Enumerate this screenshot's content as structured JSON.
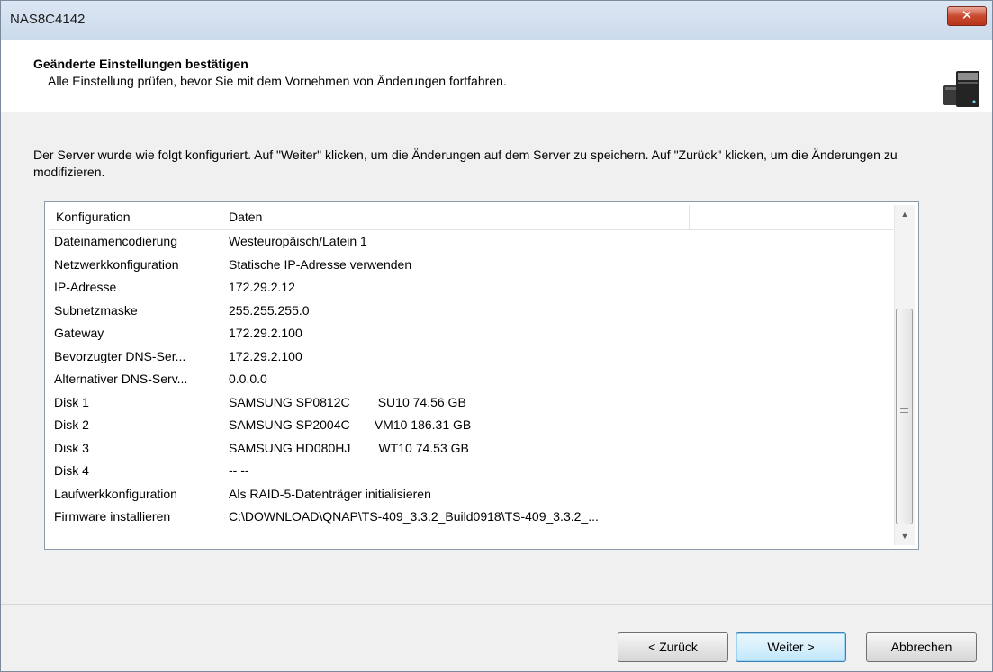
{
  "window": {
    "title": "NAS8C4142",
    "close_label": "✕"
  },
  "header": {
    "title": "Geänderte Einstellungen bestätigen",
    "subtitle": "Alle Einstellung prüfen, bevor Sie mit dem Vornehmen von Änderungen fortfahren.",
    "graphic_icon": "nas-server-icon"
  },
  "description": "Der Server wurde wie folgt konfiguriert. Auf \"Weiter\" klicken, um die Änderungen auf dem Server zu speichern. Auf \"Zurück\" klicken, um die Änderungen zu modifizieren.",
  "table": {
    "columns": [
      "Konfiguration",
      "Daten",
      ""
    ],
    "rows": [
      {
        "key": "Dateinamencodierung",
        "value": "Westeuropäisch/Latein 1"
      },
      {
        "key": "Netzwerkkonfiguration",
        "value": "Statische IP-Adresse verwenden"
      },
      {
        "key": "IP-Adresse",
        "value": "172.29.2.12"
      },
      {
        "key": "Subnetzmaske",
        "value": "255.255.255.0"
      },
      {
        "key": "Gateway",
        "value": "172.29.2.100"
      },
      {
        "key": "Bevorzugter DNS-Ser...",
        "value": "172.29.2.100"
      },
      {
        "key": "Alternativer DNS-Serv...",
        "value": "0.0.0.0"
      },
      {
        "key": "Disk 1",
        "value": "SAMSUNG SP0812C        SU10 74.56 GB"
      },
      {
        "key": "Disk 2",
        "value": "SAMSUNG SP2004C       VM10 186.31 GB"
      },
      {
        "key": "Disk 3",
        "value": "SAMSUNG HD080HJ        WT10 74.53 GB"
      },
      {
        "key": "Disk 4",
        "value": "-- --"
      },
      {
        "key": "Laufwerkkonfiguration",
        "value": "Als RAID-5-Datenträger initialisieren"
      },
      {
        "key": "Firmware installieren",
        "value": "C:\\DOWNLOAD\\QNAP\\TS-409_3.3.2_Build0918\\TS-409_3.3.2_..."
      }
    ]
  },
  "buttons": {
    "back": "< Zurück",
    "next": "Weiter >",
    "cancel": "Abbrechen"
  }
}
